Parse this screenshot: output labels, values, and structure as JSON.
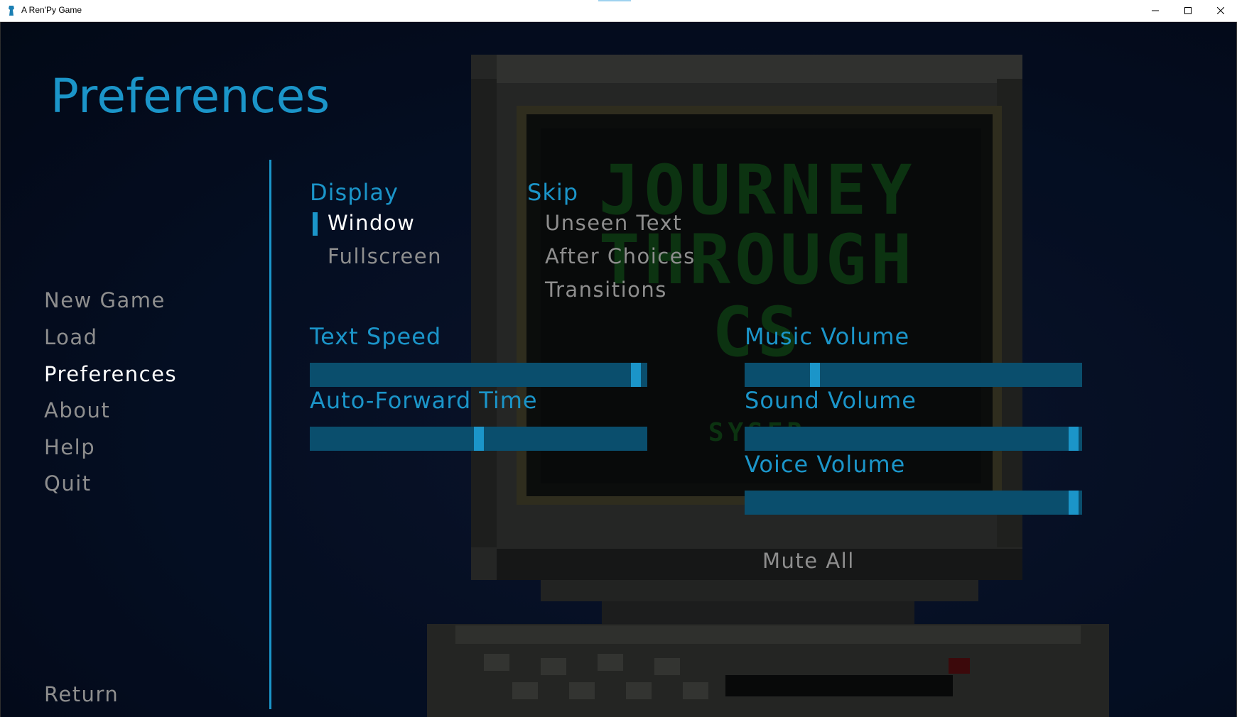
{
  "window": {
    "title": "A Ren'Py Game",
    "controls": [
      "minimize-icon",
      "maximize-icon",
      "close-icon"
    ]
  },
  "menu": {
    "title": "Preferences",
    "items": [
      {
        "label": "New Game",
        "active": false
      },
      {
        "label": "Load",
        "active": false
      },
      {
        "label": "Preferences",
        "active": true
      },
      {
        "label": "About",
        "active": false
      },
      {
        "label": "Help",
        "active": false
      },
      {
        "label": "Quit",
        "active": false
      }
    ],
    "return_label": "Return"
  },
  "display": {
    "label": "Display",
    "options": [
      {
        "label": "Window",
        "selected": true
      },
      {
        "label": "Fullscreen",
        "selected": false
      }
    ]
  },
  "skip": {
    "label": "Skip",
    "options": [
      {
        "label": "Unseen Text",
        "selected": false
      },
      {
        "label": "After Choices",
        "selected": false
      },
      {
        "label": "Transitions",
        "selected": false
      }
    ]
  },
  "sliders": {
    "text_speed": {
      "label": "Text Speed",
      "value": 0.98
    },
    "auto_forward": {
      "label": "Auto-Forward Time",
      "value": 0.5
    },
    "music_volume": {
      "label": "Music Volume",
      "value": 0.2
    },
    "sound_volume": {
      "label": "Sound Volume",
      "value": 0.99
    },
    "voice_volume": {
      "label": "Voice Volume",
      "value": 0.99
    }
  },
  "mute_all": {
    "label": "Mute All"
  },
  "colors": {
    "accent": "#1b95c9",
    "slider_bg": "#0a4e6d",
    "idle_text": "#8e8e8e",
    "active_text": "#ffffff"
  }
}
